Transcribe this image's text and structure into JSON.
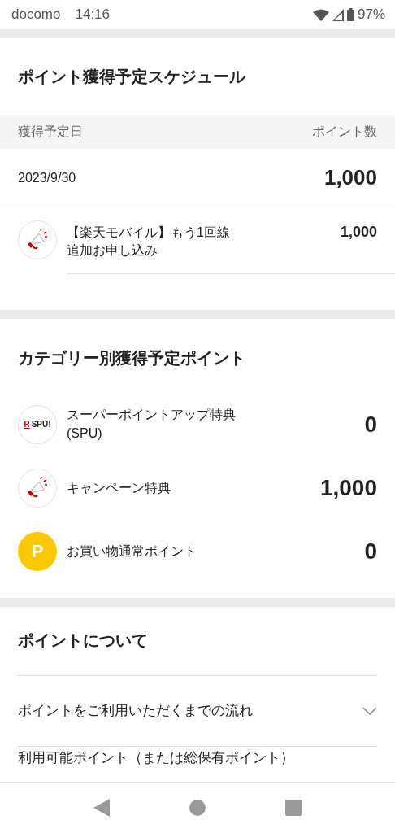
{
  "status_bar": {
    "carrier": "docomo",
    "time": "14:16",
    "battery": "97%"
  },
  "schedule": {
    "title": "ポイント獲得予定スケジュール",
    "columns": [
      "獲得予定日",
      "ポイント数"
    ],
    "groups": [
      {
        "date": "2023/9/30",
        "total": "1,000",
        "items": [
          {
            "kind": "megaphone",
            "label": "【楽天モバイル】もう1回線追加お申し込み",
            "points": "1,000"
          }
        ]
      }
    ]
  },
  "categories": {
    "title": "カテゴリー別獲得予定ポイント",
    "items": [
      {
        "kind": "spu",
        "icon_mark": "R",
        "icon_text": "SPU!",
        "label": "スーパーポイントアップ特典(SPU)",
        "points": "0"
      },
      {
        "kind": "megaphone",
        "label": "キャンペーン特典",
        "points": "1,000"
      },
      {
        "kind": "point",
        "icon_text": "P",
        "label": "お買い物通常ポイント",
        "points": "0"
      }
    ]
  },
  "about": {
    "title": "ポイントについて",
    "items": [
      {
        "label": "ポイントをご利用いただくまでの流れ",
        "expanded": false
      },
      {
        "label": "利用可能ポイント（または総保有ポイント）"
      }
    ]
  }
}
